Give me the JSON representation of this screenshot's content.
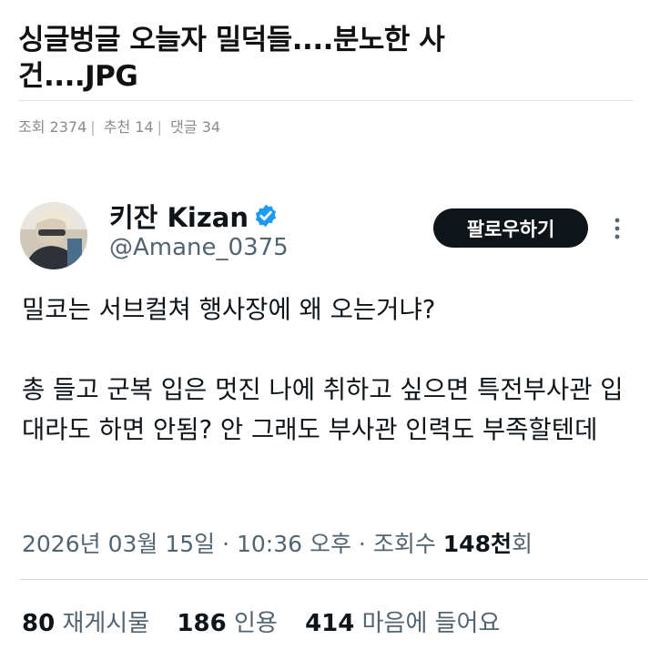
{
  "post": {
    "title": "싱글벙글 오늘자 밀덕들....분노한 사건....JPG",
    "meta": {
      "views_label": "조회",
      "views": "2374",
      "recommend_label": "추천",
      "recommend": "14",
      "comments_label": "댓글",
      "comments": "34"
    }
  },
  "tweet": {
    "author": {
      "display_name": "키잔 Kizan",
      "handle": "@Amane_0375",
      "verified": true
    },
    "follow_label": "팔로우하기",
    "body": [
      "밀코는 서브컬쳐 행사장에 왜 오는거냐?",
      "총 들고 군복 입은 멋진 나에 취하고 싶으면 특전부사관 입대라도 하면 안됨? 안 그래도 부사관 인력도 부족할텐데"
    ],
    "date": "2026년 03월 15일 · 10:36 오후 · 조회수",
    "views": "148천",
    "views_unit": "회",
    "stats": {
      "reposts": "80",
      "reposts_label": "재게시물",
      "quotes": "186",
      "quotes_label": "인용",
      "likes": "414",
      "likes_label": "마음에 들어요"
    }
  },
  "colors": {
    "verified": "#1d9bf0",
    "follow_bg": "#0f1419",
    "secondary_text": "#536471"
  },
  "icons": [
    "verified-badge-icon",
    "more-options-icon",
    "avatar-image"
  ]
}
